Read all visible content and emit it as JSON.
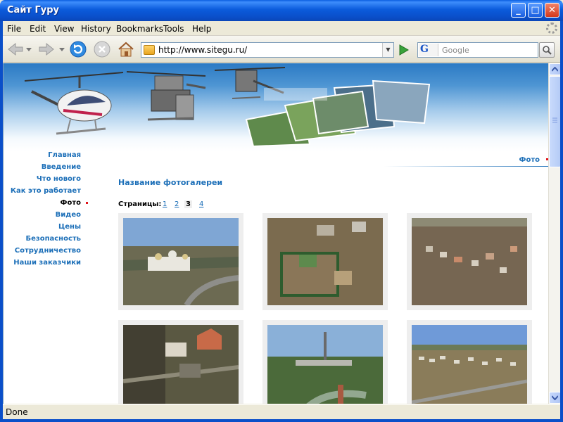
{
  "window": {
    "title": "Сайт Гуру"
  },
  "menu": [
    {
      "label": "File"
    },
    {
      "label": "Edit"
    },
    {
      "label": "View"
    },
    {
      "label": "History"
    },
    {
      "label": "Bookmarks"
    },
    {
      "label": "Tools"
    },
    {
      "label": "Help"
    }
  ],
  "toolbar": {
    "url": "http://www.sitegu.ru/",
    "search_placeholder": "Google",
    "search_engine_letter": "G"
  },
  "sidebar": {
    "items": [
      {
        "label": "Главная",
        "active": false
      },
      {
        "label": "Введение",
        "active": false
      },
      {
        "label": "Что нового",
        "active": false
      },
      {
        "label": "Как это работает",
        "active": false
      },
      {
        "label": "Фото",
        "active": true
      },
      {
        "label": "Видео",
        "active": false
      },
      {
        "label": "Цены",
        "active": false
      },
      {
        "label": "Безопасность",
        "active": false
      },
      {
        "label": "Сотрудничество",
        "active": false
      },
      {
        "label": "Наши заказчики",
        "active": false
      }
    ]
  },
  "content": {
    "breadcrumb": "Фото",
    "gallery_title": "Название фотогалереи",
    "pages_label": "Страницы:",
    "pages": [
      "1",
      "2",
      "3",
      "4"
    ],
    "current_page": "3"
  },
  "status": {
    "text": "Done"
  },
  "colors": {
    "link": "#1c6fb8",
    "accent_dot": "#e0141a",
    "titlebar": "#0a5fe0"
  }
}
